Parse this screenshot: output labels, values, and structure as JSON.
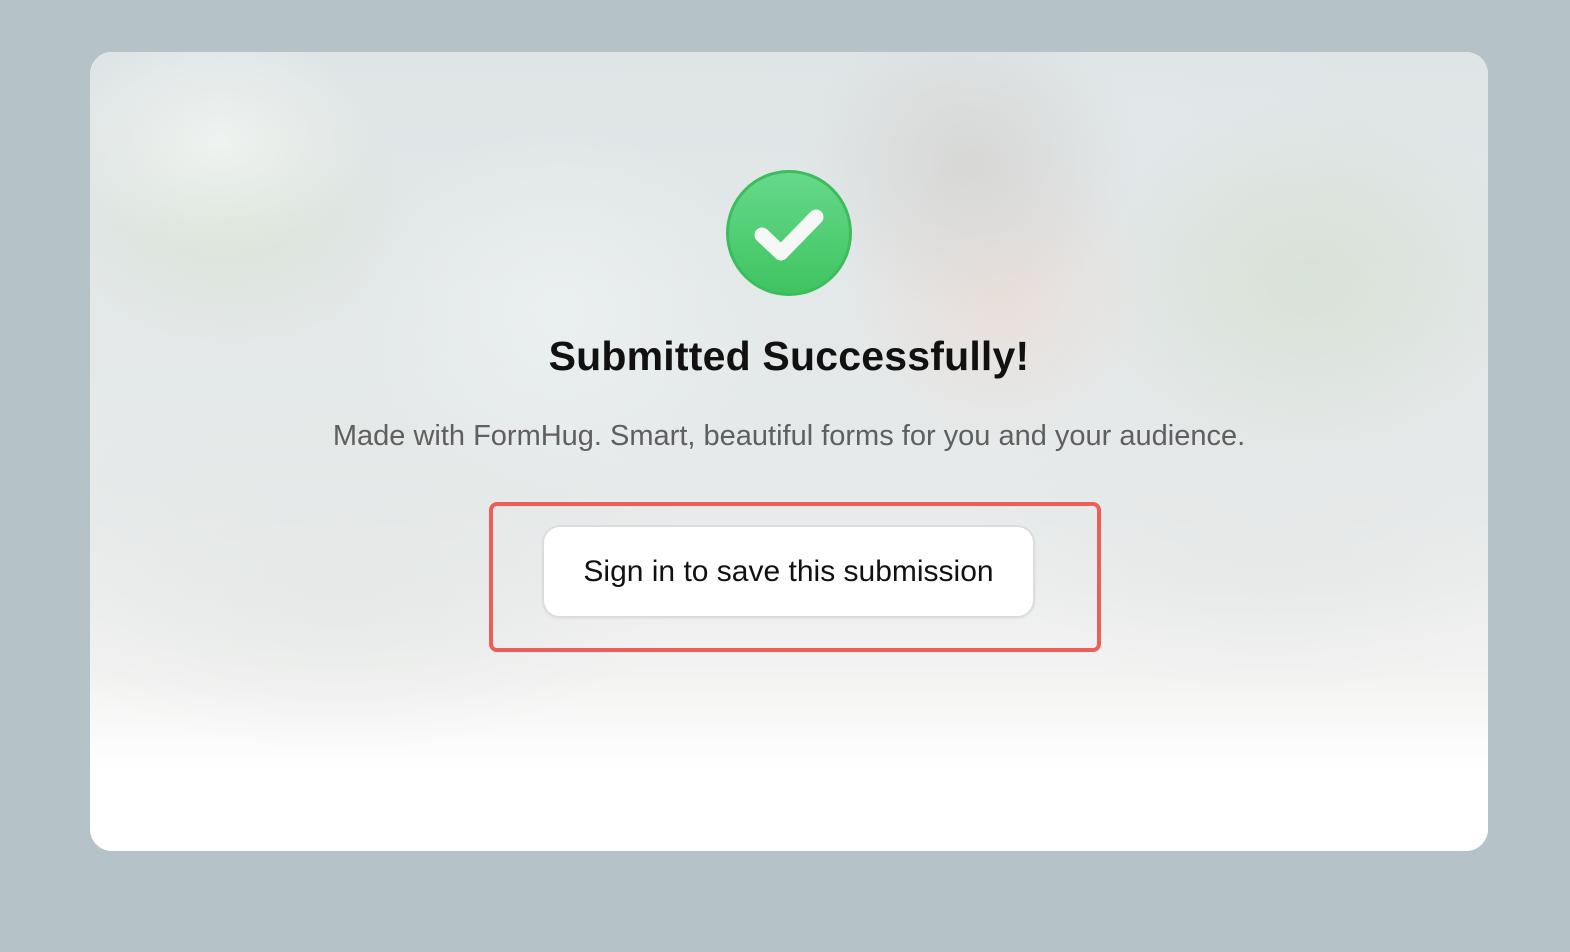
{
  "success": {
    "icon": "check-circle-icon",
    "icon_color": "#4fcf73",
    "title": "Submitted Successfully!",
    "subtitle": "Made with FormHug. Smart, beautiful forms for you and your audience."
  },
  "actions": {
    "signin_label": "Sign in to save this submission"
  },
  "colors": {
    "page_background": "#b5c3c8",
    "highlight": "#ef5d57",
    "title_text": "#111111",
    "subtitle_text": "#5f5f5f"
  }
}
